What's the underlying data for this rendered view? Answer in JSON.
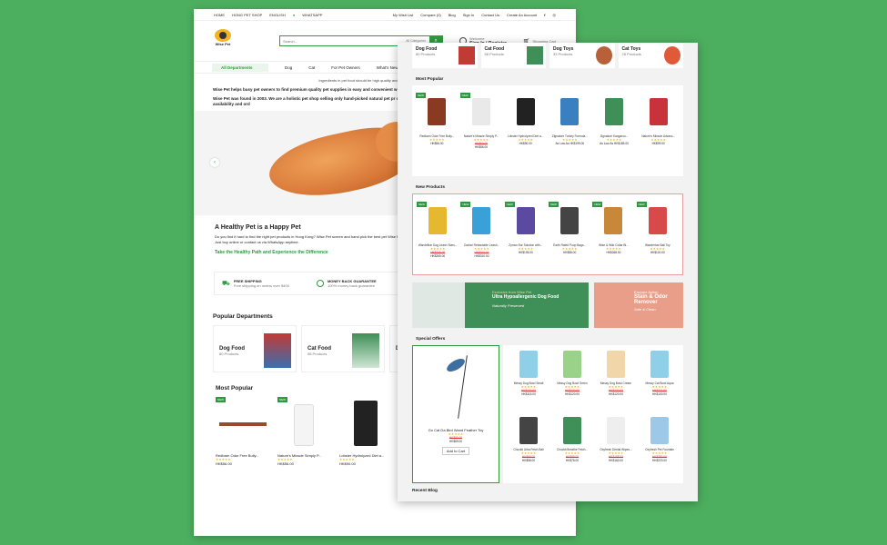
{
  "back": {
    "topbar": {
      "links_left": [
        "HOME",
        "HONG PET SHOP",
        "ENGLISH",
        "WHATSAPP"
      ],
      "links_right": [
        "My Wish List",
        "Compare (0)",
        "Blog",
        "Sign In",
        "Contact Us",
        "Create An Account"
      ]
    },
    "logo_text": "Wise Pet",
    "search": {
      "placeholder": "Search...",
      "category": "All Categories"
    },
    "account": {
      "welcome": "Welcome",
      "label": "Sign In / Register"
    },
    "cart": {
      "label": "Shopping Cart",
      "count": "0"
    },
    "nav": {
      "departments": "All Departments",
      "items": [
        "Dog",
        "Cat",
        "For Pet Owners",
        "What's New"
      ]
    },
    "notice": "Ingredients in pet food should be high quality and highly digestible. Your pet's care",
    "intro": [
      "Wise Pet helps busy pet owners to find premium quality pet supplies in easy and convenient w",
      "Wise Pet was found in 2003. We are a holistic pet shop selling only hand-picked natural pet pr credit card / Paypal will only be charged after we have confirmed product availability and ord"
    ],
    "healthy": {
      "title": "A Healthy Pet is a Happy Pet",
      "text": "Do you find it hard to find the right pet products in Hong Kong? Wise Pet screen and hand pick the best pet Wise Pet. Just buy online or contact us via WhatsApp anytime.",
      "link": "Take the Healthy Path and Experience the Difference"
    },
    "features": [
      {
        "title": "FREE SHIPPING",
        "sub": "Free shipping on orders over $400"
      },
      {
        "title": "MONEY BACK GUARANTEE",
        "sub": "100% money back guarantee"
      }
    ],
    "popular_departments": {
      "title": "Popular Departments",
      "items": [
        {
          "name": "Dog Food",
          "count": "80 Products"
        },
        {
          "name": "Cat Food",
          "count": "58 Products"
        },
        {
          "name": "Do",
          "count": ""
        }
      ]
    },
    "most_popular": {
      "title": "Most Popular",
      "items": [
        {
          "name": "Redbarn Odor Free Bully...",
          "price": "HK$56.00"
        },
        {
          "name": "Nature's Miracle Simply P...",
          "price": "HK$56.00"
        },
        {
          "name": "Lobster Hydrolyzed Diet a...",
          "price": "HK$90.00"
        }
      ]
    }
  },
  "front": {
    "top_categories": [
      {
        "name": "Dog Food",
        "count": "80 Products"
      },
      {
        "name": "Cat Food",
        "count": "58 Products"
      },
      {
        "name": "Dog Toys",
        "count": "33 Products"
      },
      {
        "name": "Cat Toys",
        "count": "28 Products"
      }
    ],
    "most_popular": {
      "title": "Most Popular",
      "items": [
        {
          "name": "Redbarn Odor Free Bully...",
          "price": "HK$56.00",
          "old": "",
          "badge": "NEW"
        },
        {
          "name": "Nature's Miracle Simply P...",
          "price": "HK$56.00",
          "old": "HK$60.00",
          "badge": "NEW"
        },
        {
          "name": "Lobster Hydrolyzed Diet a...",
          "price": "HK$90.00",
          "old": "",
          "badge": ""
        },
        {
          "name": "Zignature Turkey Formula...",
          "price": "As Low As HK$199.00",
          "old": "",
          "badge": ""
        },
        {
          "name": "Zignature Kangaroo...",
          "price": "As Low As HK$185.00",
          "old": "",
          "badge": ""
        },
        {
          "name": "Nature's Miracle Advanc...",
          "price": "HK$99.00",
          "old": "",
          "badge": ""
        }
      ]
    },
    "new_products": {
      "title": "New Products",
      "items": [
        {
          "name": "Wandelbar Dog Leash Stars...",
          "price": "HK$265.00",
          "old": "HK$265.00",
          "badge": "NEW"
        },
        {
          "name": "Zoofari Retractable Leash...",
          "price": "HK$310.00",
          "old": "HK$310.00",
          "badge": "NEW"
        },
        {
          "name": "Zymox Ear Solution with...",
          "price": "HK$195.00",
          "old": "",
          "badge": "NEW"
        },
        {
          "name": "Earth Rated Poop Bags...",
          "price": "HK$58.00",
          "old": "",
          "badge": "NEW"
        },
        {
          "name": "Wise & Wild Collar Bl...",
          "price": "HK$268.00",
          "old": "",
          "badge": "NEW"
        },
        {
          "name": "Wanderbar Ball Toy",
          "price": "HK$100.00",
          "old": "",
          "badge": "NEW"
        }
      ]
    },
    "banner1": {
      "tag": "Exclusive from Wise Pet",
      "title": "Ultra Hypoallergenic Dog Food",
      "sub": "Naturally Preserved"
    },
    "banner2": {
      "tag": "Enzyme Action",
      "title": "Stain & Odor Remover",
      "sub": "Safe & Clean"
    },
    "special_offers": {
      "title": "Special Offers",
      "featured": {
        "name": "Go Cat Da Bird Wand Feather Toy",
        "price": "HK$69.00",
        "old": "HK$80.00",
        "button": "Add to Cart"
      },
      "items": [
        {
          "name": "Messy Dog Bowl Small",
          "price": "HK$115.00",
          "old": "HK$130.00"
        },
        {
          "name": "Messy Dog Bowl Green",
          "price": "HK$120.00",
          "old": "HK$130.00"
        },
        {
          "name": "Messy Dog Bowl Cream",
          "price": "HK$120.00",
          "old": "HK$130.00"
        },
        {
          "name": "Messy Cat Bowl Aqua",
          "price": "HK$100.00",
          "old": "HK$115.00"
        },
        {
          "name": "Chuckit Ultra Fetch Ball",
          "price": "HK$58.00",
          "old": "HK$68.00"
        },
        {
          "name": "Chuckit Breathe Fetch...",
          "price": "HK$78.00",
          "old": "HK$88.00"
        },
        {
          "name": "Oxyfresh Dental Wipes...",
          "price": "HK$160.00",
          "old": "HK$188.00"
        },
        {
          "name": "Oxyfresh Pet Fountain",
          "price": "HK$220.00",
          "old": "HK$250.00"
        }
      ]
    },
    "recent_blog": {
      "title": "Recent Blog"
    },
    "below_prices": [
      "HK$265.00",
      "As Low As HK$265.00",
      "HK$90.00",
      "As Low As HK$190.00"
    ]
  },
  "colors": {
    "brand_green": "#2e9a3e",
    "background": "#4caf5f",
    "sale_red": "#d9363e"
  }
}
